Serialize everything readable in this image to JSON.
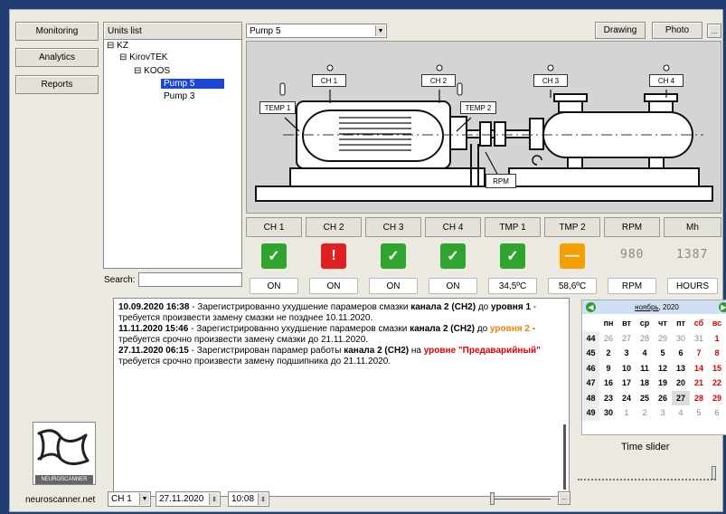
{
  "nav": {
    "monitoring": "Monitoring",
    "analytics": "Analytics",
    "reports": "Reports"
  },
  "units": {
    "title": "Units list",
    "tree": [
      "KZ",
      "KirovTEK",
      "KOOS",
      "Pump 5",
      "Pump 3"
    ],
    "selected": "Pump 5"
  },
  "unit_select": {
    "value": "Pump 5"
  },
  "top_buttons": {
    "drawing": "Drawing",
    "photo": "Photo",
    "more": "..."
  },
  "diagram_labels": {
    "ch1": "CH 1",
    "ch2": "CH 2",
    "ch3": "CH 3",
    "ch4": "CH 4",
    "temp1": "TEMP 1",
    "temp2": "TEMP 2",
    "rpm": "RPM"
  },
  "channels": {
    "headers": [
      "CH 1",
      "CH 2",
      "CH 3",
      "CH 4",
      "TMP 1",
      "TMP 2",
      "RPM",
      "Mh"
    ],
    "status": [
      "ok",
      "alarm",
      "ok",
      "ok",
      "ok",
      "warning",
      "",
      ""
    ],
    "status_colors": {
      "ok": "#2fa52f",
      "alarm": "#e02020",
      "warning": "#f5a000"
    },
    "digital": {
      "rpm": "980",
      "mh": "1387"
    },
    "values": [
      "ON",
      "ON",
      "ON",
      "ON",
      "34,5ºC",
      "58,6ºC",
      "RPM",
      "HOURS"
    ]
  },
  "search": {
    "label": "Search:",
    "value": ""
  },
  "log": {
    "e1_time": "10.09.2020 16:38",
    "e1_text1": " - Зарегистрированно ухудшение парамеров смазки ",
    "e1_channel": "канала 2 (CH2)",
    "e1_text2": " до ",
    "e1_level": "уровня 1",
    "e1_text3": " - требуется произвести замену смазки не позднее 10.11.2020.",
    "e2_time": "11.11.2020 15:46",
    "e2_text1": " - Зарегистрированно ухудшение парамеров смазки ",
    "e2_channel": "канала 2 (CH2)",
    "e2_text2": " до ",
    "e2_level": "уровня 2",
    "e2_text3": " - требуется срочно произвести замену смазки до 21.11.2020.",
    "e3_time": "27.11.2020 06:15",
    "e3_text1": " - Зарегистрирован парамер работы ",
    "e3_channel": "канала 2 (CH2)",
    "e3_text2": " на ",
    "e3_level": "уровне \"Предаварийный\"",
    "e3_text3": " требуется срочно произвести замену подшипника до 21.11.2020."
  },
  "calendar": {
    "month": "ноябрь",
    "year": "2020",
    "weekdays": [
      "пн",
      "вт",
      "ср",
      "чт",
      "пт",
      "сб",
      "вс"
    ],
    "weeks": [
      {
        "no": "44",
        "days": [
          "26",
          "27",
          "28",
          "29",
          "30",
          "31",
          "1"
        ]
      },
      {
        "no": "45",
        "days": [
          "2",
          "3",
          "4",
          "5",
          "6",
          "7",
          "8"
        ]
      },
      {
        "no": "46",
        "days": [
          "9",
          "10",
          "11",
          "12",
          "13",
          "14",
          "15"
        ]
      },
      {
        "no": "47",
        "days": [
          "16",
          "17",
          "18",
          "19",
          "20",
          "21",
          "22"
        ]
      },
      {
        "no": "48",
        "days": [
          "23",
          "24",
          "25",
          "26",
          "27",
          "28",
          "29"
        ]
      },
      {
        "no": "49",
        "days": [
          "30",
          "1",
          "2",
          "3",
          "4",
          "5",
          "6"
        ]
      }
    ],
    "selected_day": "27"
  },
  "time_slider": {
    "label": "Time slider"
  },
  "logo": {
    "text": "NEUROSCANNER"
  },
  "footer": {
    "site": "neuroscanner.net",
    "channel": "CH 1",
    "date": "27.11.2020",
    "time": "10:08",
    "more": "..."
  }
}
